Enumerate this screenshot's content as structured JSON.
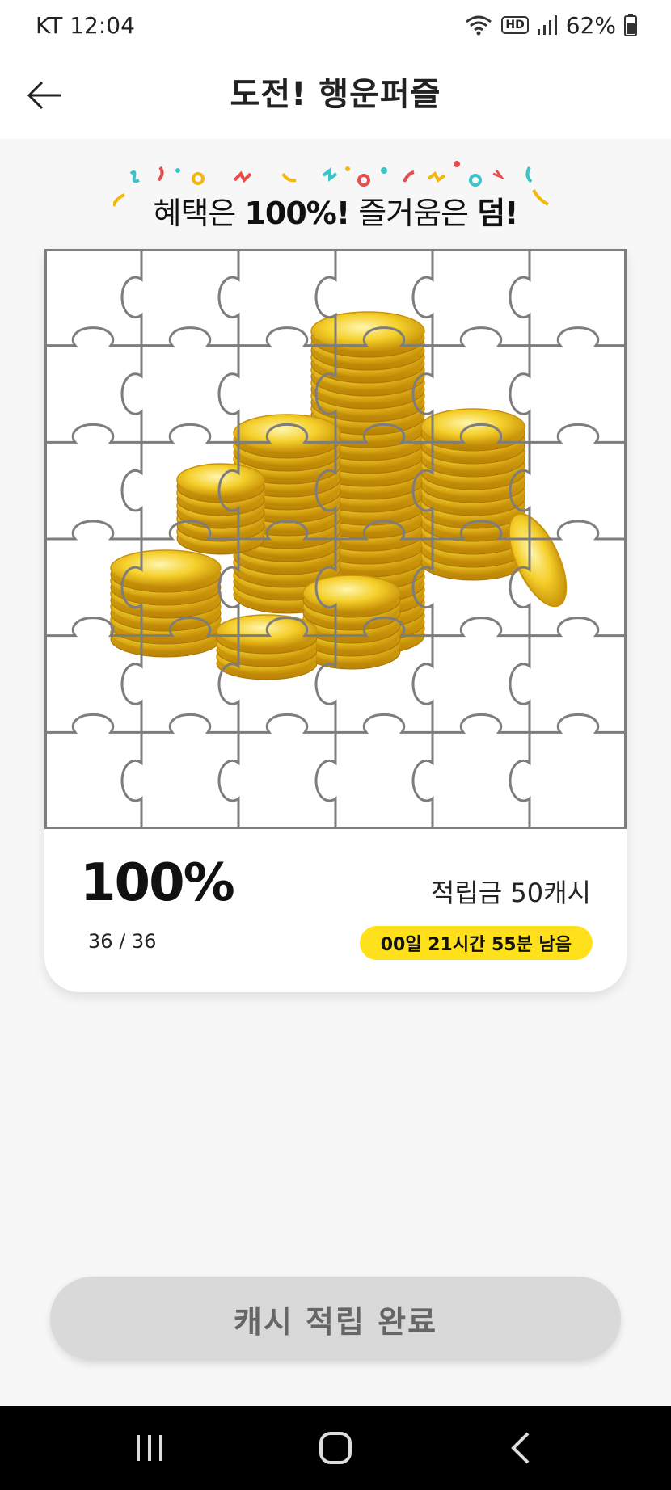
{
  "status_bar": {
    "carrier_time": "KT 12:04",
    "hd_label": "HD",
    "battery": "62%",
    "icons": [
      "wifi-icon",
      "hd-voice-icon",
      "signal-icon",
      "battery-icon"
    ]
  },
  "header": {
    "title": "도전! 행운퍼즐",
    "back_icon": "arrow-left-icon"
  },
  "banner": {
    "part1": "혜택은 ",
    "part2": "100%!",
    "part3": " 즐거움은 ",
    "part4": "덤!"
  },
  "puzzle": {
    "image": "gold-coins-image",
    "grid_rows": 6,
    "grid_cols": 6
  },
  "progress": {
    "percent": "100%",
    "count": "36 / 36",
    "reward": "적립금 50캐시",
    "remaining": "00일 21시간 55분 남음"
  },
  "action": {
    "button_label": "캐시 적립 완료"
  },
  "nav": {
    "icons": [
      "recent-apps-icon",
      "home-icon",
      "back-nav-icon"
    ]
  },
  "colors": {
    "accent_yellow": "#ffe11b",
    "button_gray": "#d9d9d9",
    "coin_gold": "#f2c21b"
  }
}
